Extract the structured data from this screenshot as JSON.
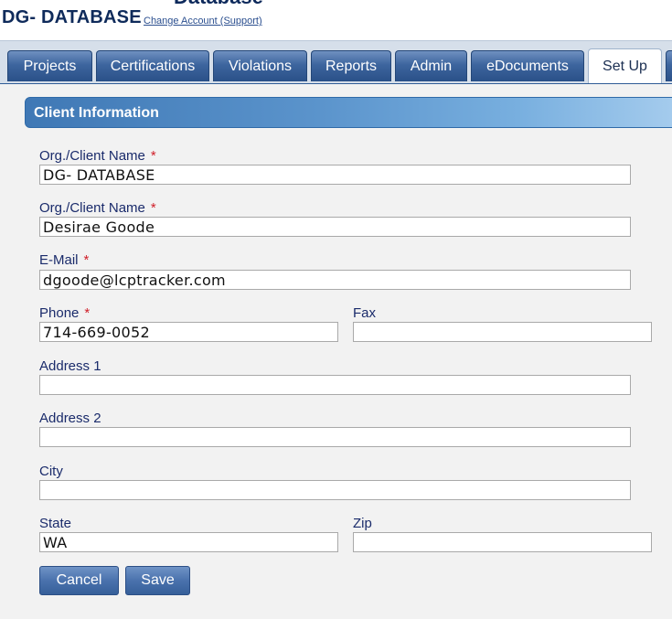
{
  "header": {
    "cut_title": "Database",
    "title": "DG- DATABASE",
    "change_account_link": "Change Account (Support)"
  },
  "tabs": [
    {
      "label": "Projects",
      "active": false
    },
    {
      "label": "Certifications",
      "active": false
    },
    {
      "label": "Violations",
      "active": false
    },
    {
      "label": "Reports",
      "active": false
    },
    {
      "label": "Admin",
      "active": false
    },
    {
      "label": "eDocuments",
      "active": false
    },
    {
      "label": "Set Up",
      "active": true
    }
  ],
  "section": {
    "title": "Client Information"
  },
  "form": {
    "org_client_name_1": {
      "label": "Org./Client Name",
      "required_mark": "*",
      "value": "DG- DATABASE"
    },
    "org_client_name_2": {
      "label": "Org./Client Name",
      "required_mark": "*",
      "value": "Desirae Goode"
    },
    "email": {
      "label": "E-Mail",
      "required_mark": "*",
      "value": "dgoode@lcptracker.com"
    },
    "phone": {
      "label": "Phone",
      "required_mark": "*",
      "value": "714-669-0052"
    },
    "fax": {
      "label": "Fax",
      "value": ""
    },
    "address1": {
      "label": "Address 1",
      "value": ""
    },
    "address2": {
      "label": "Address 2",
      "value": ""
    },
    "city": {
      "label": "City",
      "value": ""
    },
    "state": {
      "label": "State",
      "value": "WA"
    },
    "zip": {
      "label": "Zip",
      "value": ""
    }
  },
  "buttons": {
    "cancel": "Cancel",
    "save": "Save"
  },
  "colors": {
    "tab_blue": "#3d659e",
    "header_blue": "#3f78b5",
    "label_navy": "#1a2b6b",
    "required_red": "#d0202a"
  }
}
